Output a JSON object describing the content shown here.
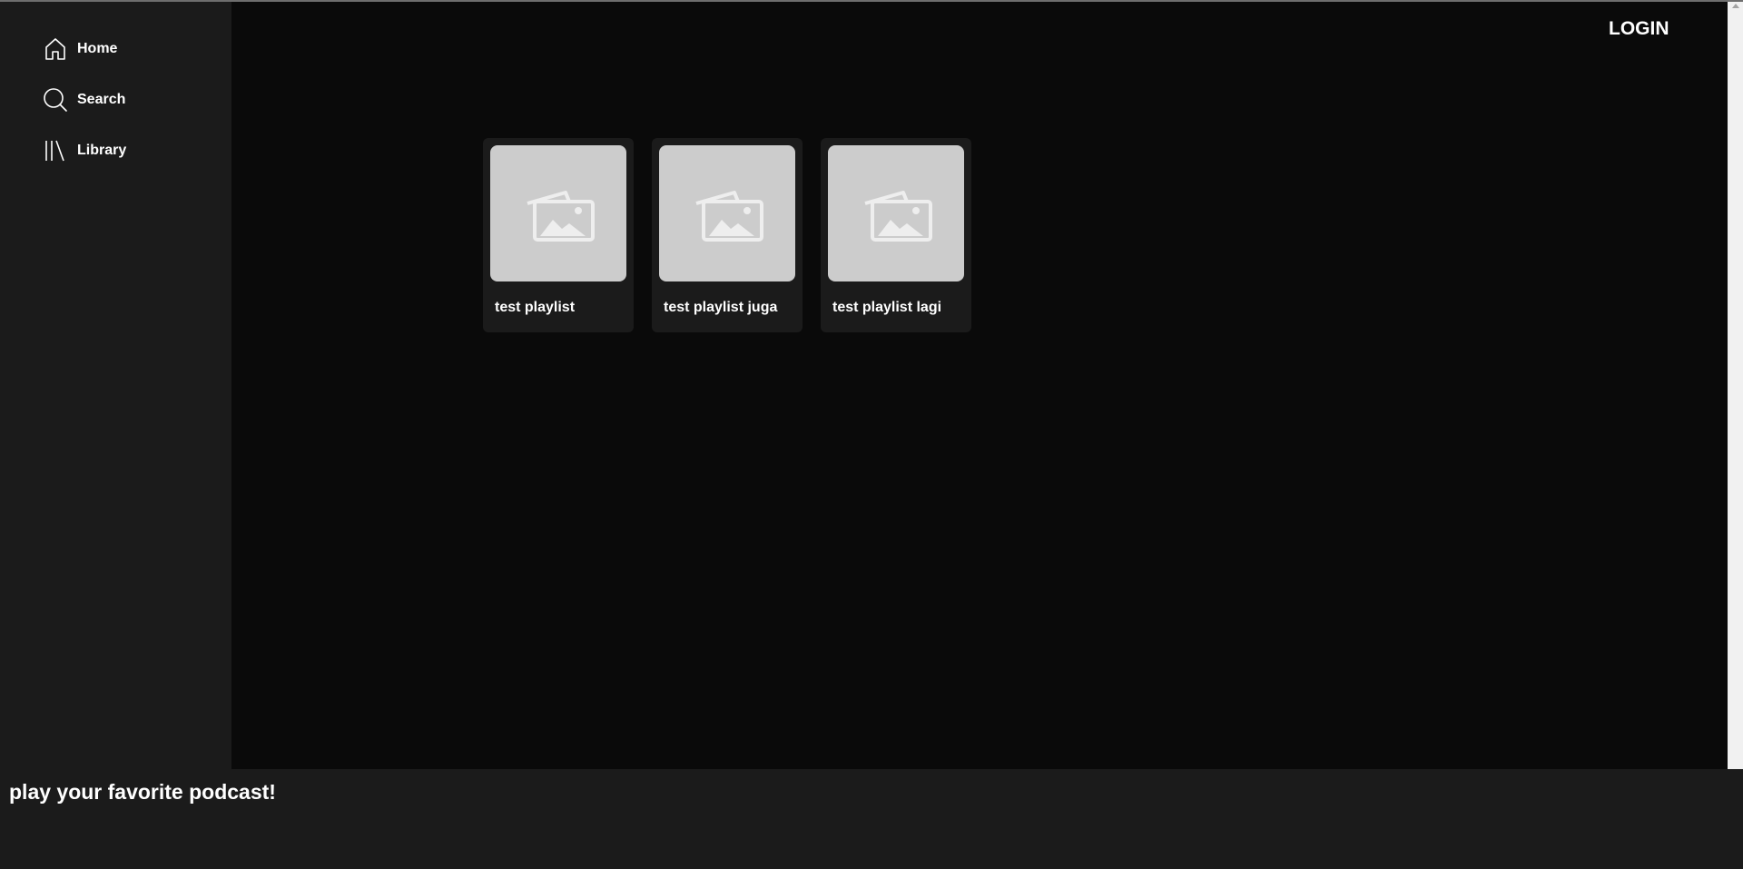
{
  "sidebar": {
    "items": [
      {
        "label": "Home",
        "icon": "home-icon"
      },
      {
        "label": "Search",
        "icon": "search-icon"
      },
      {
        "label": "Library",
        "icon": "library-icon"
      }
    ]
  },
  "header": {
    "login_label": "LOGIN"
  },
  "playlists": [
    {
      "title": "test playlist",
      "image": "image-placeholder-icon"
    },
    {
      "title": "test playlist juga",
      "image": "image-placeholder-icon"
    },
    {
      "title": "test playlist lagi",
      "image": "image-placeholder-icon"
    }
  ],
  "footer": {
    "text": "play your favorite podcast!"
  },
  "colors": {
    "sidebar_bg": "#1b1b1b",
    "main_bg": "#0a0a0a",
    "card_bg": "#1b1b1b",
    "thumb_bg": "#cccccc",
    "text": "#ffffff"
  }
}
